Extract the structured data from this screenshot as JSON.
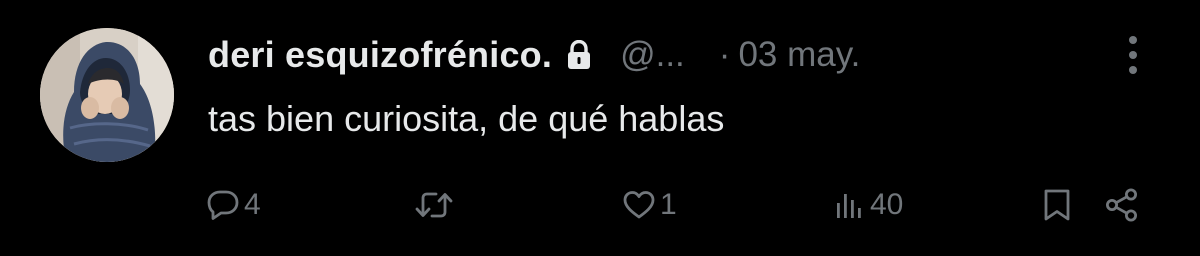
{
  "tweet": {
    "author": {
      "display_name": "deri esquizofrénico.",
      "handle": "@...",
      "protected_icon": "lock-icon",
      "avatar_icon": "avatar"
    },
    "separator": "·",
    "date": "03 may.",
    "text": "tas bien curiosita, de qué hablas",
    "actions": {
      "reply": {
        "icon": "reply-icon",
        "count": "4"
      },
      "retweet": {
        "icon": "retweet-icon",
        "count": ""
      },
      "like": {
        "icon": "heart-icon",
        "count": "1"
      },
      "views": {
        "icon": "views-icon",
        "count": "40"
      },
      "bookmark": {
        "icon": "bookmark-icon"
      },
      "share": {
        "icon": "share-icon"
      }
    },
    "colors": {
      "background": "#000000",
      "primary_text": "#e7e9ea",
      "secondary_text": "#71767b"
    }
  }
}
